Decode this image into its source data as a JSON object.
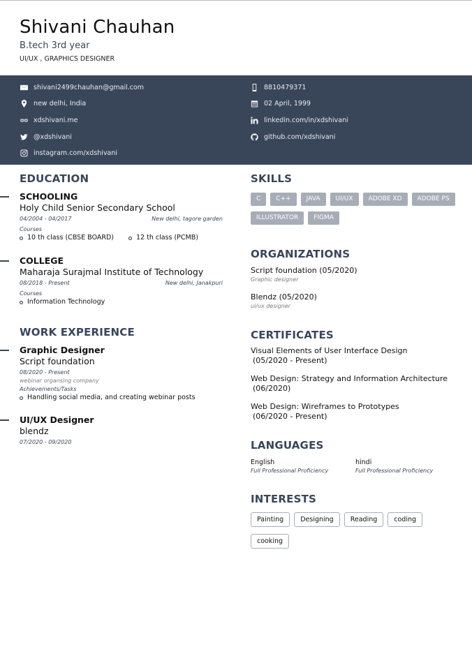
{
  "header": {
    "name": "Shivani Chauhan",
    "subtitle": "B.tech 3rd year",
    "role": "UI/UX , GRAPHICS DESIGNER"
  },
  "contact": {
    "email": "shivani2499chauhan@gmail.com",
    "phone": "8810479371",
    "location": "new delhi, India",
    "dob": "02 April, 1999",
    "website": "xdshivani.me",
    "linkedin": "linkedin.com/in/xdshivani",
    "twitter": "@xdshivani",
    "github": "github.com/xdshivani",
    "instagram": "instagram.com/xdshivani"
  },
  "education": {
    "title": "EDUCATION",
    "items": [
      {
        "level": "SCHOOLING",
        "institution": "Holy Child Senior Secondary School",
        "dates": "04/2004 - 04/2017",
        "location": "New delhi, tagore garden",
        "courses_label": "Courses",
        "courses": [
          "10 th class (CBSE BOARD)",
          "12 th class (PCMB)"
        ]
      },
      {
        "level": "COLLEGE",
        "institution": "Maharaja Surajmal Institute of Technology",
        "dates": "08/2018 - Present",
        "location": "New delhi, Janakpuri",
        "courses_label": "Courses",
        "courses": [
          "Information Technology"
        ]
      }
    ]
  },
  "work": {
    "title": "WORK EXPERIENCE",
    "items": [
      {
        "role": "Graphic Designer",
        "company": "Script foundation",
        "dates": "08/2020 - Present",
        "description": "webinar organsing company",
        "achievements_label": "Achievements/Tasks",
        "tasks": [
          "Handling social media, and creating webinar posts"
        ]
      },
      {
        "role": "UI/UX Designer",
        "company": "blendz",
        "dates": "07/2020 - 09/2020"
      }
    ]
  },
  "skills": {
    "title": "SKILLS",
    "items": [
      "C",
      "C++",
      "JAVA",
      "UI/UX",
      "ADOBE XD",
      "ADOBE PS",
      "ILLUSTRATOR",
      "FIGMA"
    ]
  },
  "organizations": {
    "title": "ORGANIZATIONS",
    "items": [
      {
        "name": "Script foundation (05/2020)",
        "role": "Graphic designer"
      },
      {
        "name": "Blendz (05/2020)",
        "role": "ui/ux designer"
      }
    ]
  },
  "certificates": {
    "title": "CERTIFICATES",
    "items": [
      {
        "name": "Visual Elements of User Interface Design",
        "dates": "(05/2020 - Present)"
      },
      {
        "name": "Web Design: Strategy and Information Architecture",
        "dates": "(06/2020)"
      },
      {
        "name": "Web Design: Wireframes to Prototypes",
        "dates": "(06/2020 - Present)"
      }
    ]
  },
  "languages": {
    "title": "LANGUAGES",
    "items": [
      {
        "name": "English",
        "level": "Full Professional Proficiency"
      },
      {
        "name": "hindi",
        "level": "Full Professional Proficiency"
      }
    ]
  },
  "interests": {
    "title": "INTERESTS",
    "items": [
      "Painting",
      "Designing",
      "Reading",
      "coding",
      "cooking"
    ]
  },
  "colors": {
    "accent": "#39465a",
    "skill_tag": "#a7adb7"
  }
}
